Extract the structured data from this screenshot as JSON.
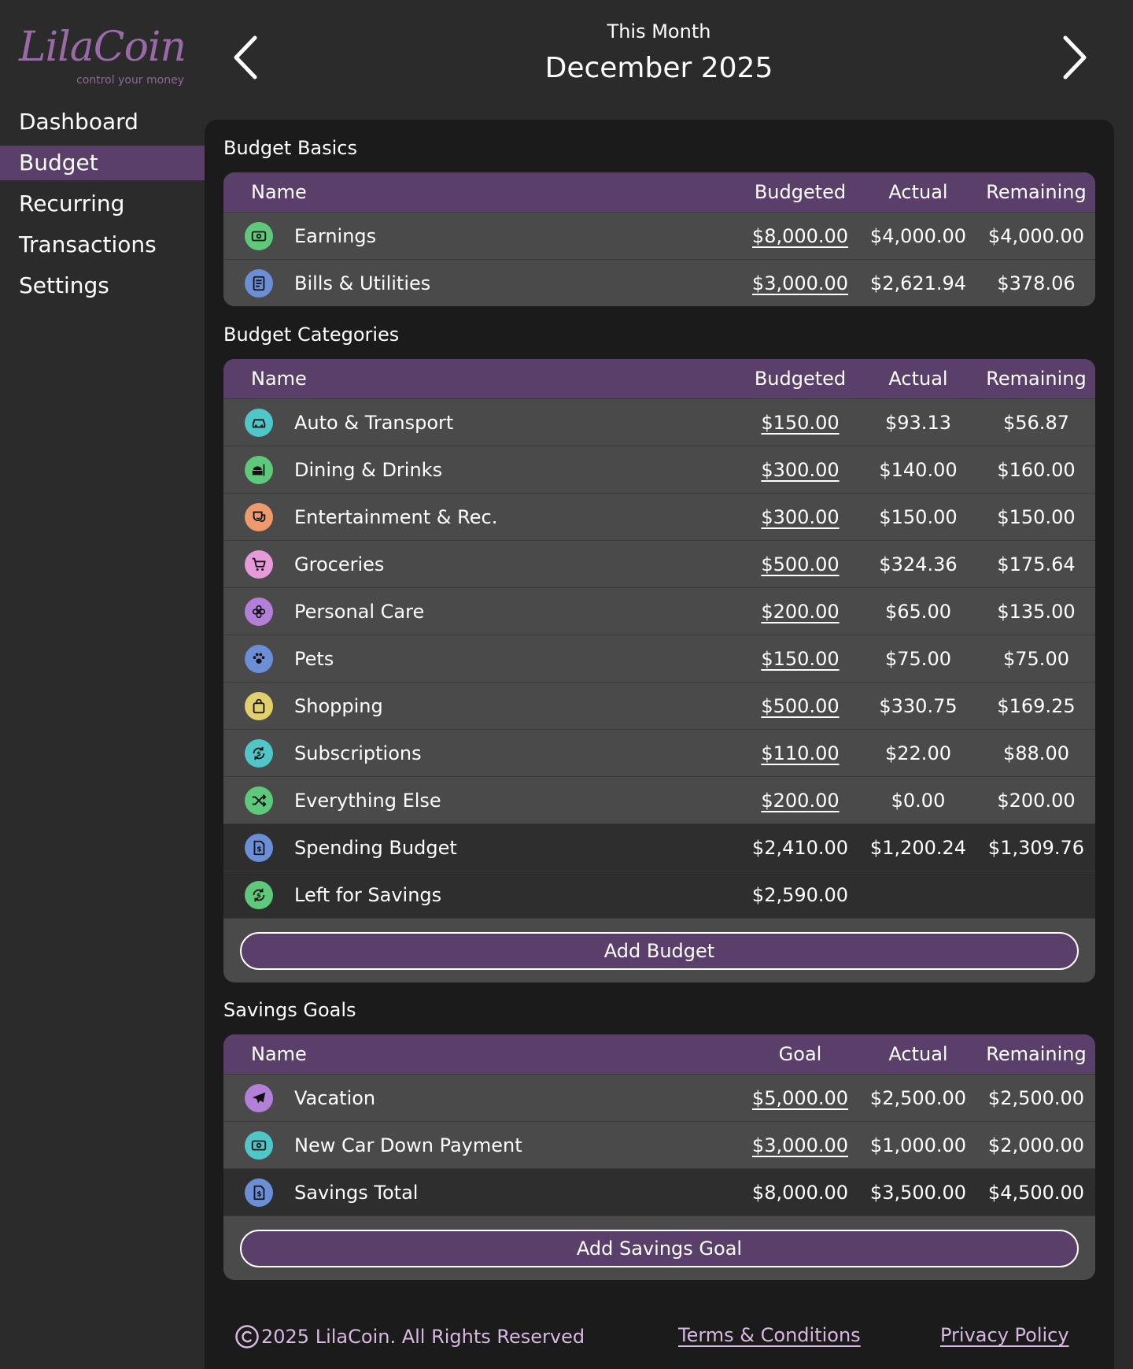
{
  "brand": {
    "name": "LilaCoin",
    "tagline": "control your money",
    "color": "#9a6aa8"
  },
  "nav": {
    "items": [
      {
        "label": "Dashboard",
        "active": false
      },
      {
        "label": "Budget",
        "active": true
      },
      {
        "label": "Recurring",
        "active": false
      },
      {
        "label": "Transactions",
        "active": false
      },
      {
        "label": "Settings",
        "active": false
      }
    ]
  },
  "header": {
    "subtitle": "This Month",
    "title": "December 2025"
  },
  "basics": {
    "title": "Budget Basics",
    "columns": [
      "Name",
      "Budgeted",
      "Actual",
      "Remaining"
    ],
    "rows": [
      {
        "icon": "money-icon",
        "color": "#5ec97a",
        "name": "Earnings",
        "budgeted": "$8,000.00",
        "actual": "$4,000.00",
        "remaining": "$4,000.00"
      },
      {
        "icon": "bill-icon",
        "color": "#6b8fd6",
        "name": "Bills & Utilities",
        "budgeted": "$3,000.00",
        "actual": "$2,621.94",
        "remaining": "$378.06"
      }
    ]
  },
  "categories": {
    "title": "Budget Categories",
    "columns": [
      "Name",
      "Budgeted",
      "Actual",
      "Remaining"
    ],
    "rows": [
      {
        "icon": "car-icon",
        "color": "#4fc7c9",
        "name": "Auto & Transport",
        "budgeted": "$150.00",
        "actual": "$93.13",
        "remaining": "$56.87"
      },
      {
        "icon": "food-icon",
        "color": "#5ec97a",
        "name": "Dining & Drinks",
        "budgeted": "$300.00",
        "actual": "$140.00",
        "remaining": "$160.00"
      },
      {
        "icon": "theater-icon",
        "color": "#ef9a6b",
        "name": "Entertainment & Rec.",
        "budgeted": "$300.00",
        "actual": "$150.00",
        "remaining": "$150.00"
      },
      {
        "icon": "cart-icon",
        "color": "#e79ad8",
        "name": "Groceries",
        "budgeted": "$500.00",
        "actual": "$324.36",
        "remaining": "$175.64"
      },
      {
        "icon": "flower-icon",
        "color": "#b27fd9",
        "name": "Personal Care",
        "budgeted": "$200.00",
        "actual": "$65.00",
        "remaining": "$135.00"
      },
      {
        "icon": "paw-icon",
        "color": "#6b8fd6",
        "name": "Pets",
        "budgeted": "$150.00",
        "actual": "$75.00",
        "remaining": "$75.00"
      },
      {
        "icon": "bag-icon",
        "color": "#e2d16a",
        "name": "Shopping",
        "budgeted": "$500.00",
        "actual": "$330.75",
        "remaining": "$169.25"
      },
      {
        "icon": "refresh-dollar-icon",
        "color": "#4fc7c9",
        "name": "Subscriptions",
        "budgeted": "$110.00",
        "actual": "$22.00",
        "remaining": "$88.00"
      },
      {
        "icon": "shuffle-icon",
        "color": "#5ec97a",
        "name": "Everything Else",
        "budgeted": "$200.00",
        "actual": "$0.00",
        "remaining": "$200.00"
      }
    ],
    "totals": [
      {
        "icon": "receipt-dollar-icon",
        "color": "#6b8fd6",
        "name": "Spending Budget",
        "budgeted": "$2,410.00",
        "actual": "$1,200.24",
        "remaining": "$1,309.76"
      },
      {
        "icon": "refresh-dollar-icon",
        "color": "#5ec97a",
        "name": "Left for Savings",
        "budgeted": "$2,590.00",
        "actual": "",
        "remaining": ""
      }
    ],
    "button": "Add Budget"
  },
  "savings": {
    "title": "Savings Goals",
    "columns": [
      "Name",
      "Goal",
      "Actual",
      "Remaining"
    ],
    "rows": [
      {
        "icon": "plane-icon",
        "color": "#b27fd9",
        "name": "Vacation",
        "budgeted": "$5,000.00",
        "actual": "$2,500.00",
        "remaining": "$2,500.00"
      },
      {
        "icon": "money-icon",
        "color": "#4fc7c9",
        "name": "New Car Down Payment",
        "budgeted": "$3,000.00",
        "actual": "$1,000.00",
        "remaining": "$2,000.00"
      }
    ],
    "totals": [
      {
        "icon": "receipt-dollar-icon",
        "color": "#6b8fd6",
        "name": "Savings Total",
        "budgeted": "$8,000.00",
        "actual": "$3,500.00",
        "remaining": "$4,500.00"
      }
    ],
    "button": "Add Savings Goal"
  },
  "footer": {
    "copyright": "2025 LilaCoin. All Rights Reserved",
    "terms": "Terms & Conditions",
    "privacy": "Privacy Policy"
  }
}
